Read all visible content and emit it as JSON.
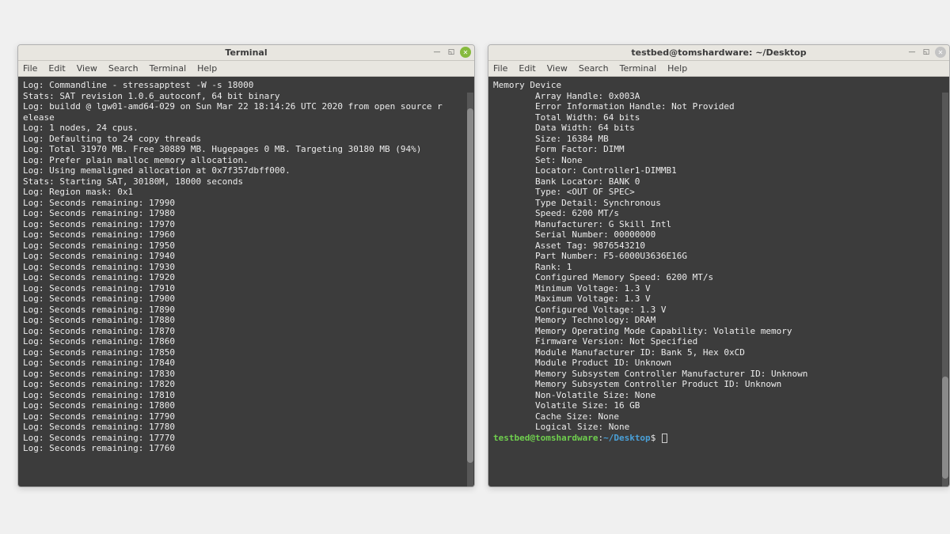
{
  "menus": [
    "File",
    "Edit",
    "View",
    "Search",
    "Terminal",
    "Help"
  ],
  "left": {
    "title": "Terminal",
    "lines": [
      "Log: Commandline - stressapptest -W -s 18000",
      "Stats: SAT revision 1.0.6_autoconf, 64 bit binary",
      "Log: buildd @ lgw01-amd64-029 on Sun Mar 22 18:14:26 UTC 2020 from open source r",
      "elease",
      "Log: 1 nodes, 24 cpus.",
      "Log: Defaulting to 24 copy threads",
      "Log: Total 31970 MB. Free 30889 MB. Hugepages 0 MB. Targeting 30180 MB (94%)",
      "Log: Prefer plain malloc memory allocation.",
      "Log: Using memaligned allocation at 0x7f357dbff000.",
      "Stats: Starting SAT, 30180M, 18000 seconds",
      "Log: Region mask: 0x1",
      "Log: Seconds remaining: 17990",
      "Log: Seconds remaining: 17980",
      "Log: Seconds remaining: 17970",
      "Log: Seconds remaining: 17960",
      "Log: Seconds remaining: 17950",
      "Log: Seconds remaining: 17940",
      "Log: Seconds remaining: 17930",
      "Log: Seconds remaining: 17920",
      "Log: Seconds remaining: 17910",
      "Log: Seconds remaining: 17900",
      "Log: Seconds remaining: 17890",
      "Log: Seconds remaining: 17880",
      "Log: Seconds remaining: 17870",
      "Log: Seconds remaining: 17860",
      "Log: Seconds remaining: 17850",
      "Log: Seconds remaining: 17840",
      "Log: Seconds remaining: 17830",
      "Log: Seconds remaining: 17820",
      "Log: Seconds remaining: 17810",
      "Log: Seconds remaining: 17800",
      "Log: Seconds remaining: 17790",
      "Log: Seconds remaining: 17780",
      "Log: Seconds remaining: 17770",
      "Log: Seconds remaining: 17760"
    ],
    "scrollbar": {
      "thumb_top_pct": 4,
      "thumb_height_pct": 90
    }
  },
  "right": {
    "title": "testbed@tomshardware: ~/Desktop",
    "lines": [
      "Memory Device",
      "        Array Handle: 0x003A",
      "        Error Information Handle: Not Provided",
      "        Total Width: 64 bits",
      "        Data Width: 64 bits",
      "        Size: 16384 MB",
      "        Form Factor: DIMM",
      "        Set: None",
      "        Locator: Controller1-DIMMB1",
      "        Bank Locator: BANK 0",
      "        Type: <OUT OF SPEC>",
      "        Type Detail: Synchronous",
      "        Speed: 6200 MT/s",
      "        Manufacturer: G Skill Intl",
      "        Serial Number: 00000000",
      "        Asset Tag: 9876543210",
      "        Part Number: F5-6000U3636E16G",
      "        Rank: 1",
      "        Configured Memory Speed: 6200 MT/s",
      "        Minimum Voltage: 1.3 V",
      "        Maximum Voltage: 1.3 V",
      "        Configured Voltage: 1.3 V",
      "        Memory Technology: DRAM",
      "        Memory Operating Mode Capability: Volatile memory",
      "        Firmware Version: Not Specified",
      "        Module Manufacturer ID: Bank 5, Hex 0xCD",
      "        Module Product ID: Unknown",
      "        Memory Subsystem Controller Manufacturer ID: Unknown",
      "        Memory Subsystem Controller Product ID: Unknown",
      "        Non-Volatile Size: None",
      "        Volatile Size: 16 GB",
      "        Cache Size: None",
      "        Logical Size: None"
    ],
    "prompt": {
      "user": "testbed@tomshardware",
      "path": "~/Desktop",
      "sep": ":",
      "dollar": "$"
    },
    "scrollbar": {
      "thumb_top_pct": 72,
      "thumb_height_pct": 26
    }
  }
}
